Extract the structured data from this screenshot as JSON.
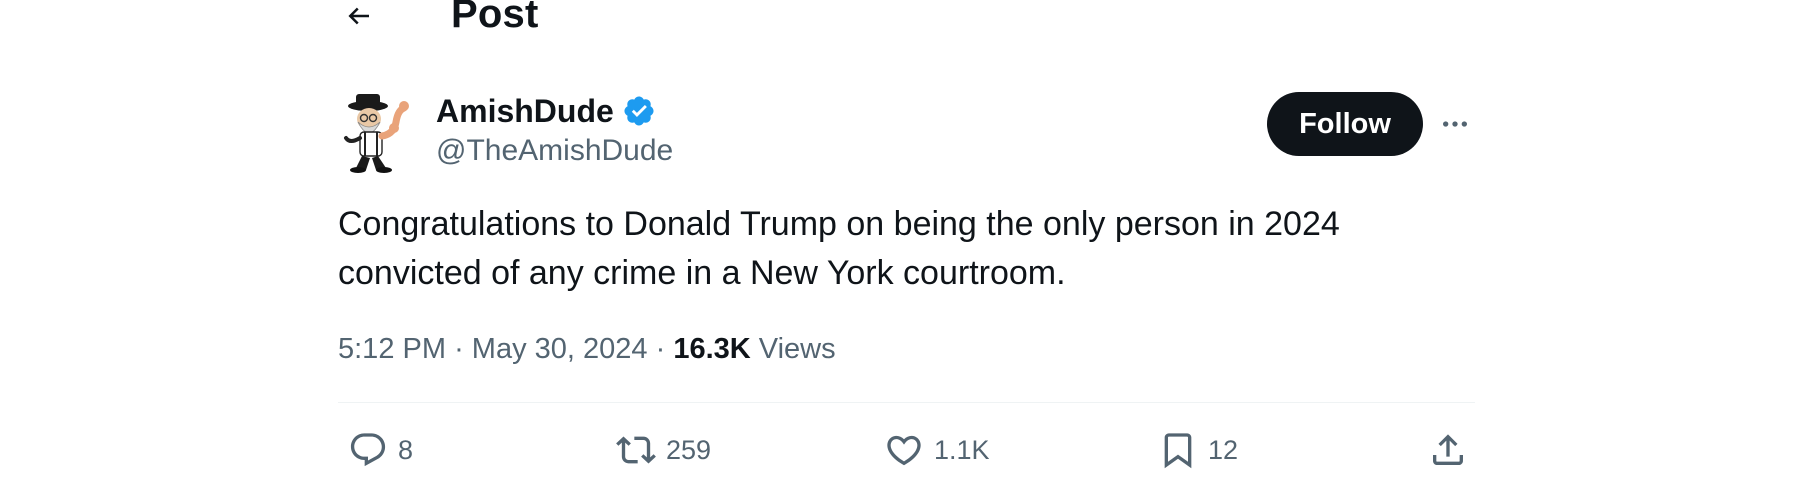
{
  "header": {
    "back_icon": "arrow-left-icon",
    "title": "Post"
  },
  "author": {
    "display_name": "AmishDude",
    "handle": "@TheAmishDude",
    "verified_icon": "verified-badge-icon",
    "verified_color": "#1d9bf0",
    "avatar_icon": "cartoon-amish-man-flexing-avatar"
  },
  "actions_top": {
    "follow_label": "Follow",
    "more_icon": "more-horizontal-icon"
  },
  "tweet": {
    "text": "Congratulations to Donald Trump on being the only person in 2024 convicted of any crime in a New York courtroom.",
    "time": "5:12 PM",
    "separator": "·",
    "date": "May 30, 2024",
    "views_count": "16.3K",
    "views_label": "Views"
  },
  "engagement": {
    "reply": {
      "icon": "reply-icon",
      "count": "8"
    },
    "repost": {
      "icon": "repost-icon",
      "count": "259"
    },
    "like": {
      "icon": "heart-icon",
      "count": "1.1K"
    },
    "bookmark": {
      "icon": "bookmark-icon",
      "count": "12"
    },
    "share": {
      "icon": "share-icon"
    }
  },
  "colors": {
    "text_primary": "#0f1419",
    "text_secondary": "#536471",
    "follow_bg": "#0f1419",
    "follow_text": "#ffffff",
    "divider": "#eff3f4"
  }
}
